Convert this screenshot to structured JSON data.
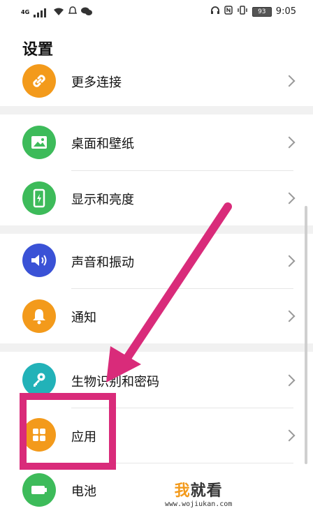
{
  "status_bar": {
    "network": "4G",
    "battery": "93",
    "time": "9:05"
  },
  "page_title": "设置",
  "items": [
    {
      "label": "更多连接",
      "icon": "link-icon",
      "color": "#f39a1b"
    },
    {
      "label": "桌面和壁纸",
      "icon": "image-icon",
      "color": "#3dbb5a"
    },
    {
      "label": "显示和亮度",
      "icon": "display-icon",
      "color": "#3dbb5a"
    },
    {
      "label": "声音和振动",
      "icon": "speaker-icon",
      "color": "#3a52d6"
    },
    {
      "label": "通知",
      "icon": "bell-icon",
      "color": "#f39a1b"
    },
    {
      "label": "生物识别和密码",
      "icon": "key-icon",
      "color": "#22b2b8"
    },
    {
      "label": "应用",
      "icon": "apps-grid-icon",
      "color": "#f39a1b"
    },
    {
      "label": "电池",
      "icon": "battery-icon",
      "color": "#3dbb5a"
    }
  ],
  "annotation_color": "#d92b7a",
  "watermark": {
    "brand_first": "我",
    "brand_rest": "就看",
    "url": "www.wojiukan.com",
    "accent_color": "#f39a1b"
  }
}
